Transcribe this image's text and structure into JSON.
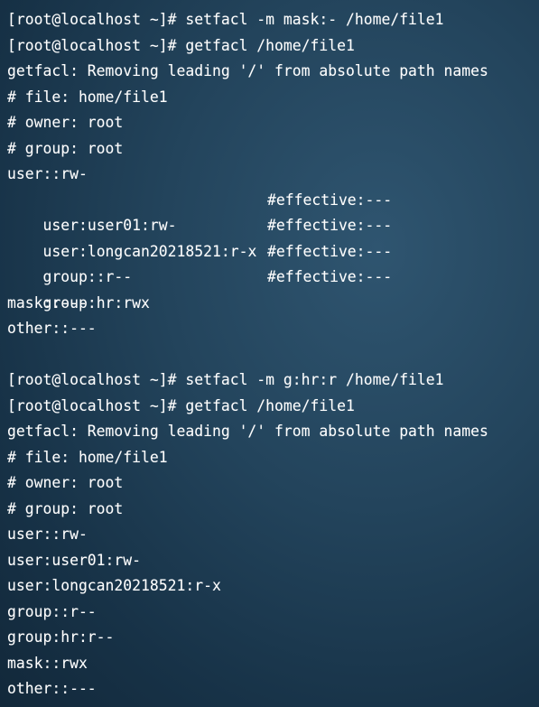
{
  "terminal": {
    "block1": {
      "cmd1": "[root@localhost ~]# setfacl -m mask:- /home/file1",
      "cmd2": "[root@localhost ~]# getfacl /home/file1",
      "msg": "getfacl: Removing leading '/' from absolute path names",
      "file": "# file: home/file1",
      "owner": "# owner: root",
      "group": "# group: root",
      "user_entry": "user::rw-",
      "user01": "user:user01:rw-",
      "user01_effective": "#effective:---",
      "longcan": "user:longcan20218521:r-x",
      "longcan_effective": "#effective:---",
      "group_entry": "group::r--",
      "group_effective": "#effective:---",
      "group_hr": "group:hr:rwx",
      "group_hr_effective": "#effective:---",
      "mask": "mask::---",
      "other": "other::---"
    },
    "block2": {
      "cmd1": "[root@localhost ~]# setfacl -m g:hr:r /home/file1",
      "cmd2": "[root@localhost ~]# getfacl /home/file1",
      "msg": "getfacl: Removing leading '/' from absolute path names",
      "file": "# file: home/file1",
      "owner": "# owner: root",
      "group": "# group: root",
      "user_entry": "user::rw-",
      "user01": "user:user01:rw-",
      "longcan": "user:longcan20218521:r-x",
      "group_entry": "group::r--",
      "group_hr": "group:hr:r--",
      "mask": "mask::rwx",
      "other": "other::---"
    }
  }
}
